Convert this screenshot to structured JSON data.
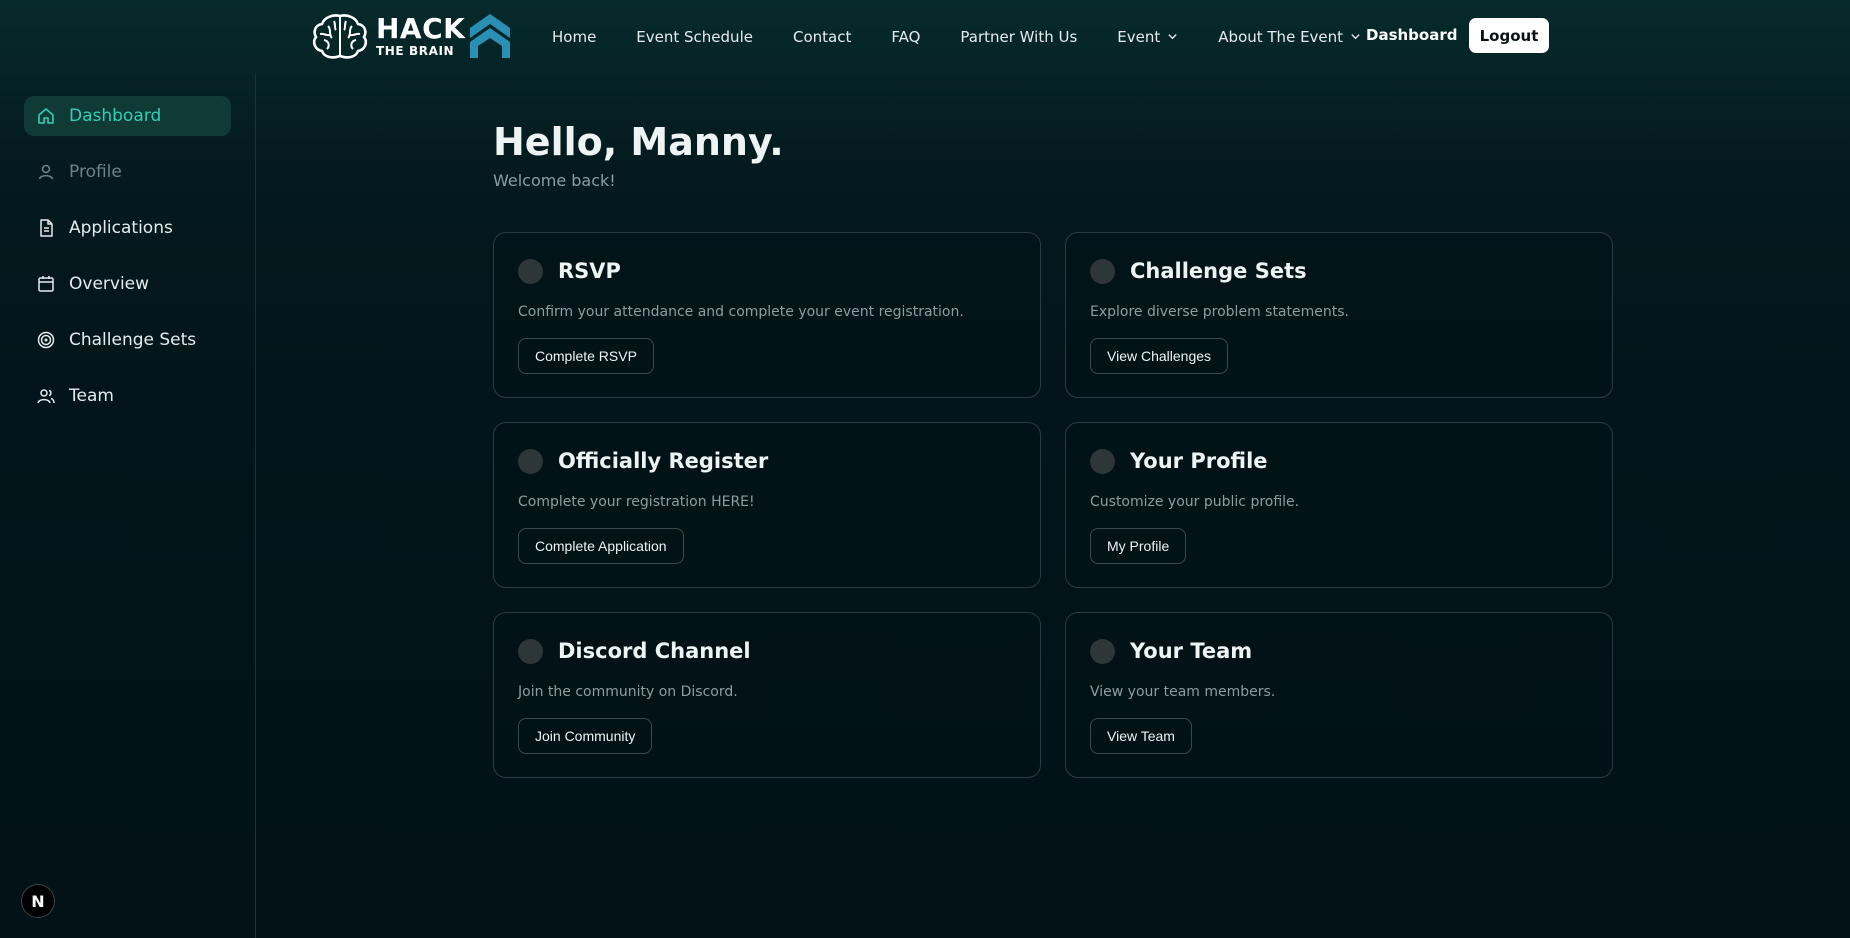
{
  "brand": {
    "line1": "HACK",
    "line2": "THE BRAIN"
  },
  "nav": {
    "links": [
      {
        "label": "Home"
      },
      {
        "label": "Event Schedule"
      },
      {
        "label": "Contact"
      },
      {
        "label": "FAQ"
      },
      {
        "label": "Partner With Us"
      },
      {
        "label": "Event"
      },
      {
        "label": "About The Event"
      }
    ],
    "dashboard_label": "Dashboard",
    "logout_label": "Logout"
  },
  "sidebar": {
    "items": [
      {
        "label": "Dashboard",
        "icon": "home-icon",
        "active": true
      },
      {
        "label": "Profile",
        "icon": "user-icon",
        "muted": true
      },
      {
        "label": "Applications",
        "icon": "document-icon"
      },
      {
        "label": "Overview",
        "icon": "calendar-icon"
      },
      {
        "label": "Challenge Sets",
        "icon": "target-icon"
      },
      {
        "label": "Team",
        "icon": "users-icon"
      }
    ],
    "badge_label": "N"
  },
  "main": {
    "greeting": "Hello, Manny.",
    "subtitle": "Welcome back!",
    "cards": [
      {
        "title": "RSVP",
        "description": "Confirm your attendance and complete your event registration.",
        "button": "Complete RSVP"
      },
      {
        "title": "Challenge Sets",
        "description": "Explore diverse problem statements.",
        "button": "View Challenges"
      },
      {
        "title": "Officially Register",
        "description": "Complete your registration HERE!",
        "button": "Complete Application"
      },
      {
        "title": "Your Profile",
        "description": "Customize your public profile.",
        "button": "My Profile"
      },
      {
        "title": "Discord Channel",
        "description": "Join the community on Discord.",
        "button": "Join Community"
      },
      {
        "title": "Your Team",
        "description": "View your team members.",
        "button": "View Team"
      }
    ]
  },
  "colors": {
    "accent": "#2fd1b6",
    "background": "#03151a",
    "card_border": "#2a3c41"
  }
}
